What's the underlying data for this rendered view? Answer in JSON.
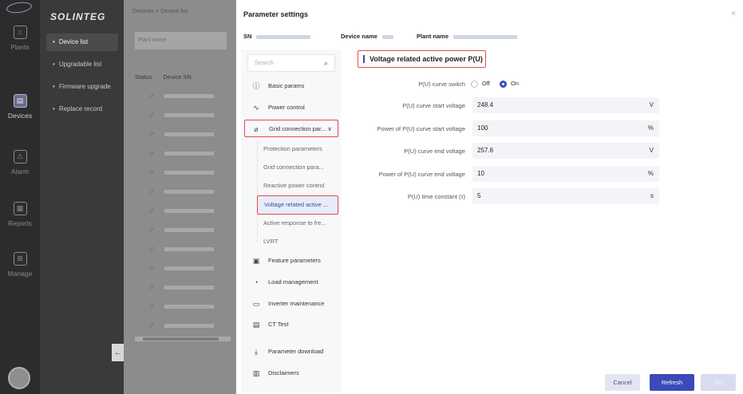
{
  "rail": {
    "items": [
      {
        "label": "Plants",
        "icon": "home-icon",
        "glyph": "⌂"
      },
      {
        "label": "Devices",
        "icon": "device-icon",
        "glyph": "▤"
      },
      {
        "label": "Alarm",
        "icon": "alarm-icon",
        "glyph": "⚠"
      },
      {
        "label": "Reports",
        "icon": "report-icon",
        "glyph": "▦"
      },
      {
        "label": "Manage",
        "icon": "grid-icon",
        "glyph": "⊞"
      }
    ]
  },
  "subnav": {
    "brand": "SOLINTEG",
    "items": [
      "Device list",
      "Upgradable list",
      "Firmware upgrade",
      "Replace record"
    ],
    "collapse_glyph": "←"
  },
  "background": {
    "breadcrumb": "Devices > Device list",
    "search_placeholder": "Plant name",
    "col_status": "Status",
    "col_sn": "Device SN"
  },
  "modal": {
    "title": "Parameter settings",
    "close": "×",
    "sn_label": "SN",
    "device_name_label": "Device name",
    "plant_name_label": "Plant name",
    "search_placeholder": "Search",
    "menu": [
      {
        "label": "Basic params",
        "icon": "info-icon",
        "glyph": "ⓘ"
      },
      {
        "label": "Power control",
        "icon": "pulse-icon",
        "glyph": "∿"
      },
      {
        "label": "Grid connection par... ∨",
        "icon": "link-icon",
        "glyph": "⌀"
      },
      {
        "label": "Feature parameters",
        "icon": "doc-icon",
        "glyph": "▣"
      },
      {
        "label": "Load management",
        "icon": "gauge-icon",
        "glyph": "◔"
      },
      {
        "label": "Inverter maintenance",
        "icon": "maintenance-icon",
        "glyph": "▭"
      },
      {
        "label": "CT Test",
        "icon": "ct-icon",
        "glyph": "▤"
      },
      {
        "label": "Parameter download",
        "icon": "download-icon",
        "glyph": "⤓"
      },
      {
        "label": "Disclaimers",
        "icon": "disclaimer-icon",
        "glyph": "▥"
      }
    ],
    "submenu": [
      "Protection parameters",
      "Grid connection para...",
      "Reactive power control",
      "Voltage related active ...",
      "Active response to fre...",
      "LVRT"
    ],
    "section_title": "Voltage related active power P(U)",
    "switch_label": "P(U) curve switch",
    "off_label": "Off",
    "on_label": "On",
    "fields": [
      {
        "label": "P(U) curve start voltage",
        "value": "248.4",
        "unit": "V"
      },
      {
        "label": "Power of P(U) curve start voltage",
        "value": "100",
        "unit": "%"
      },
      {
        "label": "P(U) curve end voltage",
        "value": "257.6",
        "unit": "V"
      },
      {
        "label": "Power of P(U) curve end voltage",
        "value": "10",
        "unit": "%"
      },
      {
        "label": "P(U) time constant (τ)",
        "value": "5",
        "unit": "s"
      }
    ],
    "buttons": {
      "cancel": "Cancel",
      "refresh": "Refresh",
      "set": "Set"
    }
  }
}
